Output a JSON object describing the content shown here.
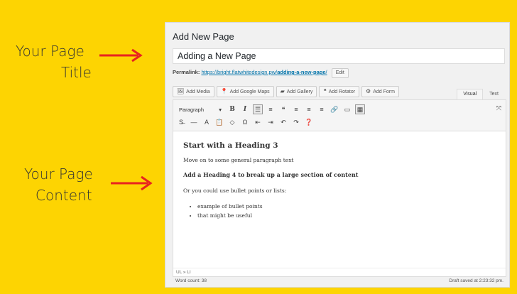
{
  "callouts": {
    "title": {
      "line1": "Your Page",
      "line2": "Title"
    },
    "content": {
      "line1": "Your Page",
      "line2": "Content"
    },
    "arrow_color": "#e8231f"
  },
  "panel": {
    "heading": "Add New Page",
    "title_value": "Adding a New Page",
    "permalink": {
      "label": "Permalink:",
      "url_base": "https://bright.flatwhitedesign.pw/",
      "url_slug": "adding-a-new-page",
      "url_end": "/",
      "edit_label": "Edit"
    },
    "media_buttons": [
      {
        "icon": "media-icon",
        "glyph": "🖼",
        "label": "Add Media"
      },
      {
        "icon": "map-pin-icon",
        "glyph": "📍",
        "label": "Add Google Maps"
      },
      {
        "icon": "gallery-icon",
        "glyph": "▰",
        "label": "Add Gallery"
      },
      {
        "icon": "quote-icon",
        "glyph": "❝",
        "label": "Add Rotator"
      },
      {
        "icon": "form-icon",
        "glyph": "⚙",
        "label": "Add Form"
      }
    ],
    "tabs": {
      "visual": "Visual",
      "text": "Text"
    },
    "toolbar": {
      "format_value": "Paragraph",
      "row1": [
        {
          "name": "bold-icon",
          "glyph": "B",
          "cls": "bold"
        },
        {
          "name": "italic-icon",
          "glyph": "I",
          "cls": "ital"
        },
        {
          "name": "bullet-list-icon",
          "glyph": "☰",
          "cls": "on"
        },
        {
          "name": "numbered-list-icon",
          "glyph": "≡",
          "cls": ""
        },
        {
          "name": "blockquote-icon",
          "glyph": "❝",
          "cls": ""
        },
        {
          "name": "align-left-icon",
          "glyph": "≡",
          "cls": ""
        },
        {
          "name": "align-center-icon",
          "glyph": "≡",
          "cls": ""
        },
        {
          "name": "align-right-icon",
          "glyph": "≡",
          "cls": ""
        },
        {
          "name": "link-icon",
          "glyph": "🔗",
          "cls": ""
        },
        {
          "name": "read-more-icon",
          "glyph": "▭",
          "cls": ""
        },
        {
          "name": "toolbar-toggle-icon",
          "glyph": "▦",
          "cls": "on"
        }
      ],
      "row2": [
        {
          "name": "strikethrough-icon",
          "glyph": "S̶",
          "cls": ""
        },
        {
          "name": "horizontal-line-icon",
          "glyph": "—",
          "cls": ""
        },
        {
          "name": "text-color-icon",
          "glyph": "A",
          "cls": ""
        },
        {
          "name": "paste-text-icon",
          "glyph": "📋",
          "cls": ""
        },
        {
          "name": "clear-format-icon",
          "glyph": "◇",
          "cls": ""
        },
        {
          "name": "special-char-icon",
          "glyph": "Ω",
          "cls": ""
        },
        {
          "name": "outdent-icon",
          "glyph": "⇤",
          "cls": ""
        },
        {
          "name": "indent-icon",
          "glyph": "⇥",
          "cls": ""
        },
        {
          "name": "undo-icon",
          "glyph": "↶",
          "cls": ""
        },
        {
          "name": "redo-icon",
          "glyph": "↷",
          "cls": ""
        },
        {
          "name": "help-icon",
          "glyph": "❓",
          "cls": ""
        }
      ]
    },
    "content": {
      "heading3": "Start with a Heading 3",
      "para1": "Move on to some general paragraph text",
      "heading4": "Add a Heading 4 to break up a large section of content",
      "para2": "Or you could use bullet points or lists:",
      "bullets": [
        "example of bullet points",
        "that might be useful"
      ]
    },
    "path": "UL » LI",
    "word_count": "Word count: 38",
    "draft_status": "Draft saved at 2:23:32 pm."
  }
}
